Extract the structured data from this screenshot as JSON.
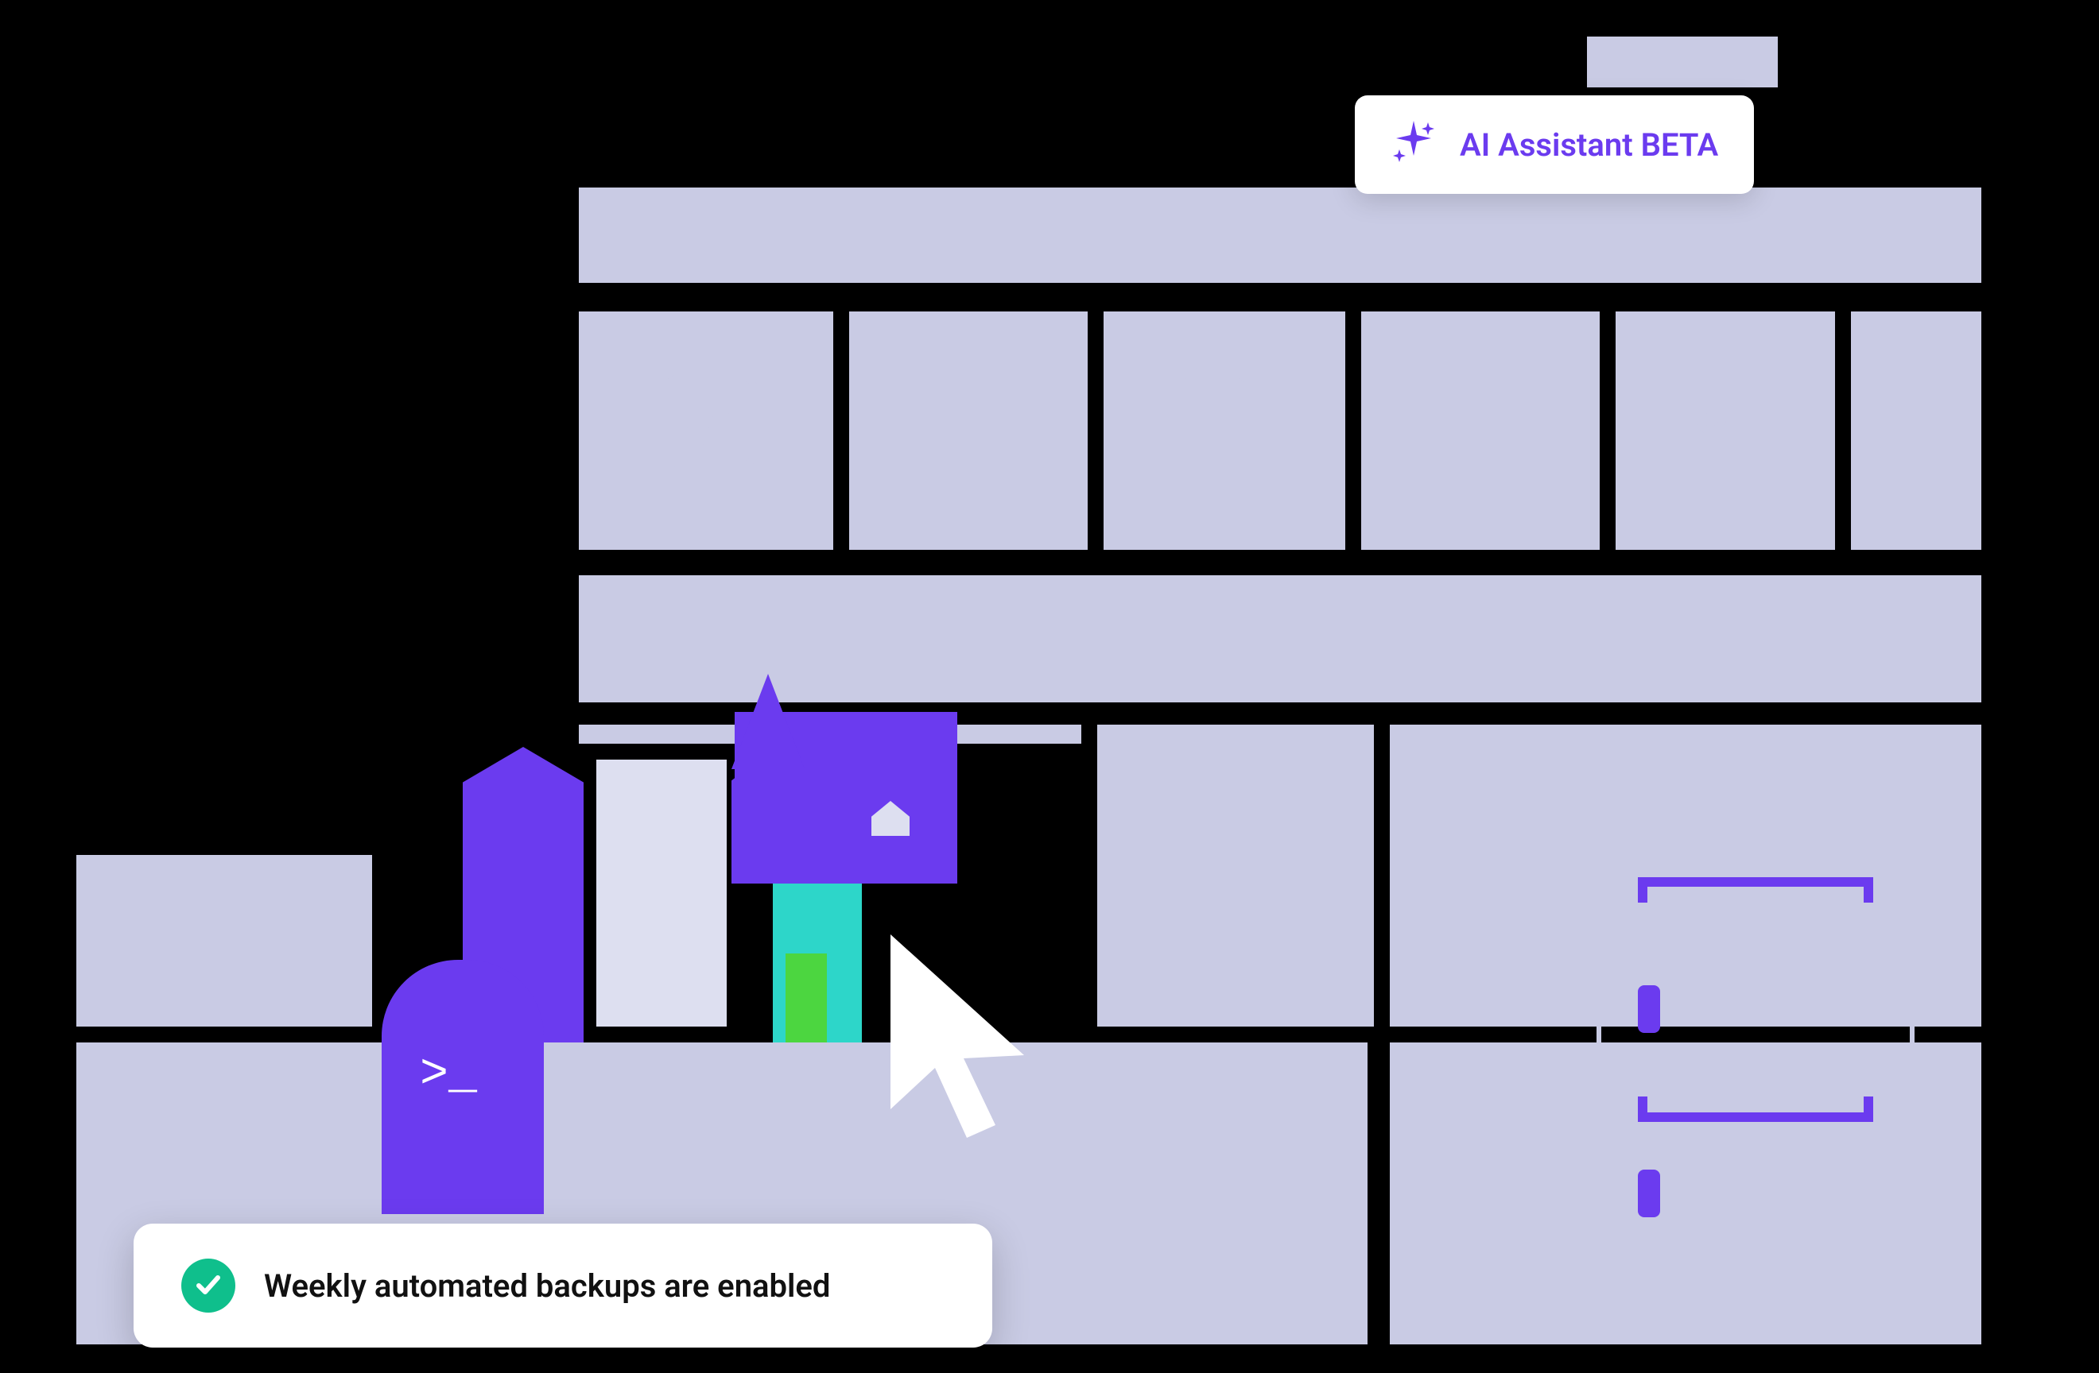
{
  "ai_assistant": {
    "label": "AI Assistant BETA"
  },
  "toast": {
    "message": "Weekly automated backups are enabled"
  },
  "colors": {
    "block": "#C9CBE4",
    "accent": "#6B3BEF",
    "success": "#0FBF8C",
    "cyan": "#2DD6C9",
    "green": "#4CD640"
  }
}
